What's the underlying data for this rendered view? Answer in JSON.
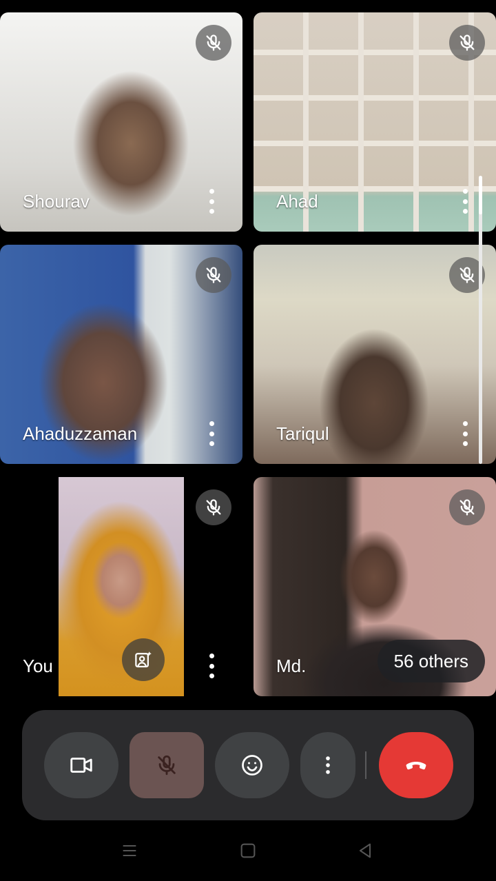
{
  "participants": [
    {
      "name": "Shourav",
      "muted": true
    },
    {
      "name": "Ahad",
      "muted": true
    },
    {
      "name": "Ahaduzzaman",
      "muted": true
    },
    {
      "name": "Tariqul",
      "muted": true
    },
    {
      "name": "You",
      "muted": true
    },
    {
      "name": "Md.",
      "muted": true
    }
  ],
  "others_count_label": "56 others",
  "controls": {
    "camera": "video-camera-icon",
    "microphone": "microphone-off-icon",
    "reactions": "emoji-icon",
    "more": "more-vert-icon",
    "end_call": "end-call-icon"
  },
  "colors": {
    "end_call": "#e53935",
    "mic_off_bg": "#6b5452",
    "control_bar": "#2b2b2d"
  },
  "nav": [
    "recents-icon",
    "home-icon",
    "back-icon"
  ]
}
